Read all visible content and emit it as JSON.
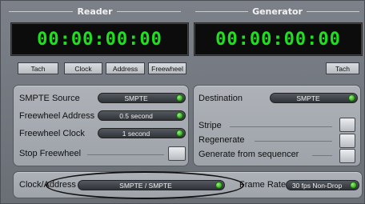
{
  "reader": {
    "title": "Reader",
    "timecode": "00:00:00:00",
    "buttons": [
      "Tach",
      "Clock",
      "Address",
      "Freewheel"
    ]
  },
  "generator": {
    "title": "Generator",
    "timecode": "00:00:00:00",
    "tach_label": "Tach"
  },
  "reader_settings": {
    "smpte_source_label": "SMPTE Source",
    "smpte_source_value": "SMPTE",
    "freewheel_address_label": "Freewheel Address",
    "freewheel_address_value": "0.5 second",
    "freewheel_clock_label": "Freewheel Clock",
    "freewheel_clock_value": "1 second",
    "stop_freewheel_label": "Stop Freewheel"
  },
  "generator_settings": {
    "destination_label": "Destination",
    "destination_value": "SMPTE",
    "stripe_label": "Stripe",
    "regenerate_label": "Regenerate",
    "generate_from_sequencer_label": "Generate from sequencer"
  },
  "bottom": {
    "clock_address_label": "Clock/Address",
    "clock_address_value": "SMPTE / SMPTE",
    "frame_rate_label": "Frame Rate",
    "frame_rate_value": "30 fps Non-Drop"
  },
  "colors": {
    "lcd_digits": "#1ee01e",
    "led": "#2ea61b"
  }
}
